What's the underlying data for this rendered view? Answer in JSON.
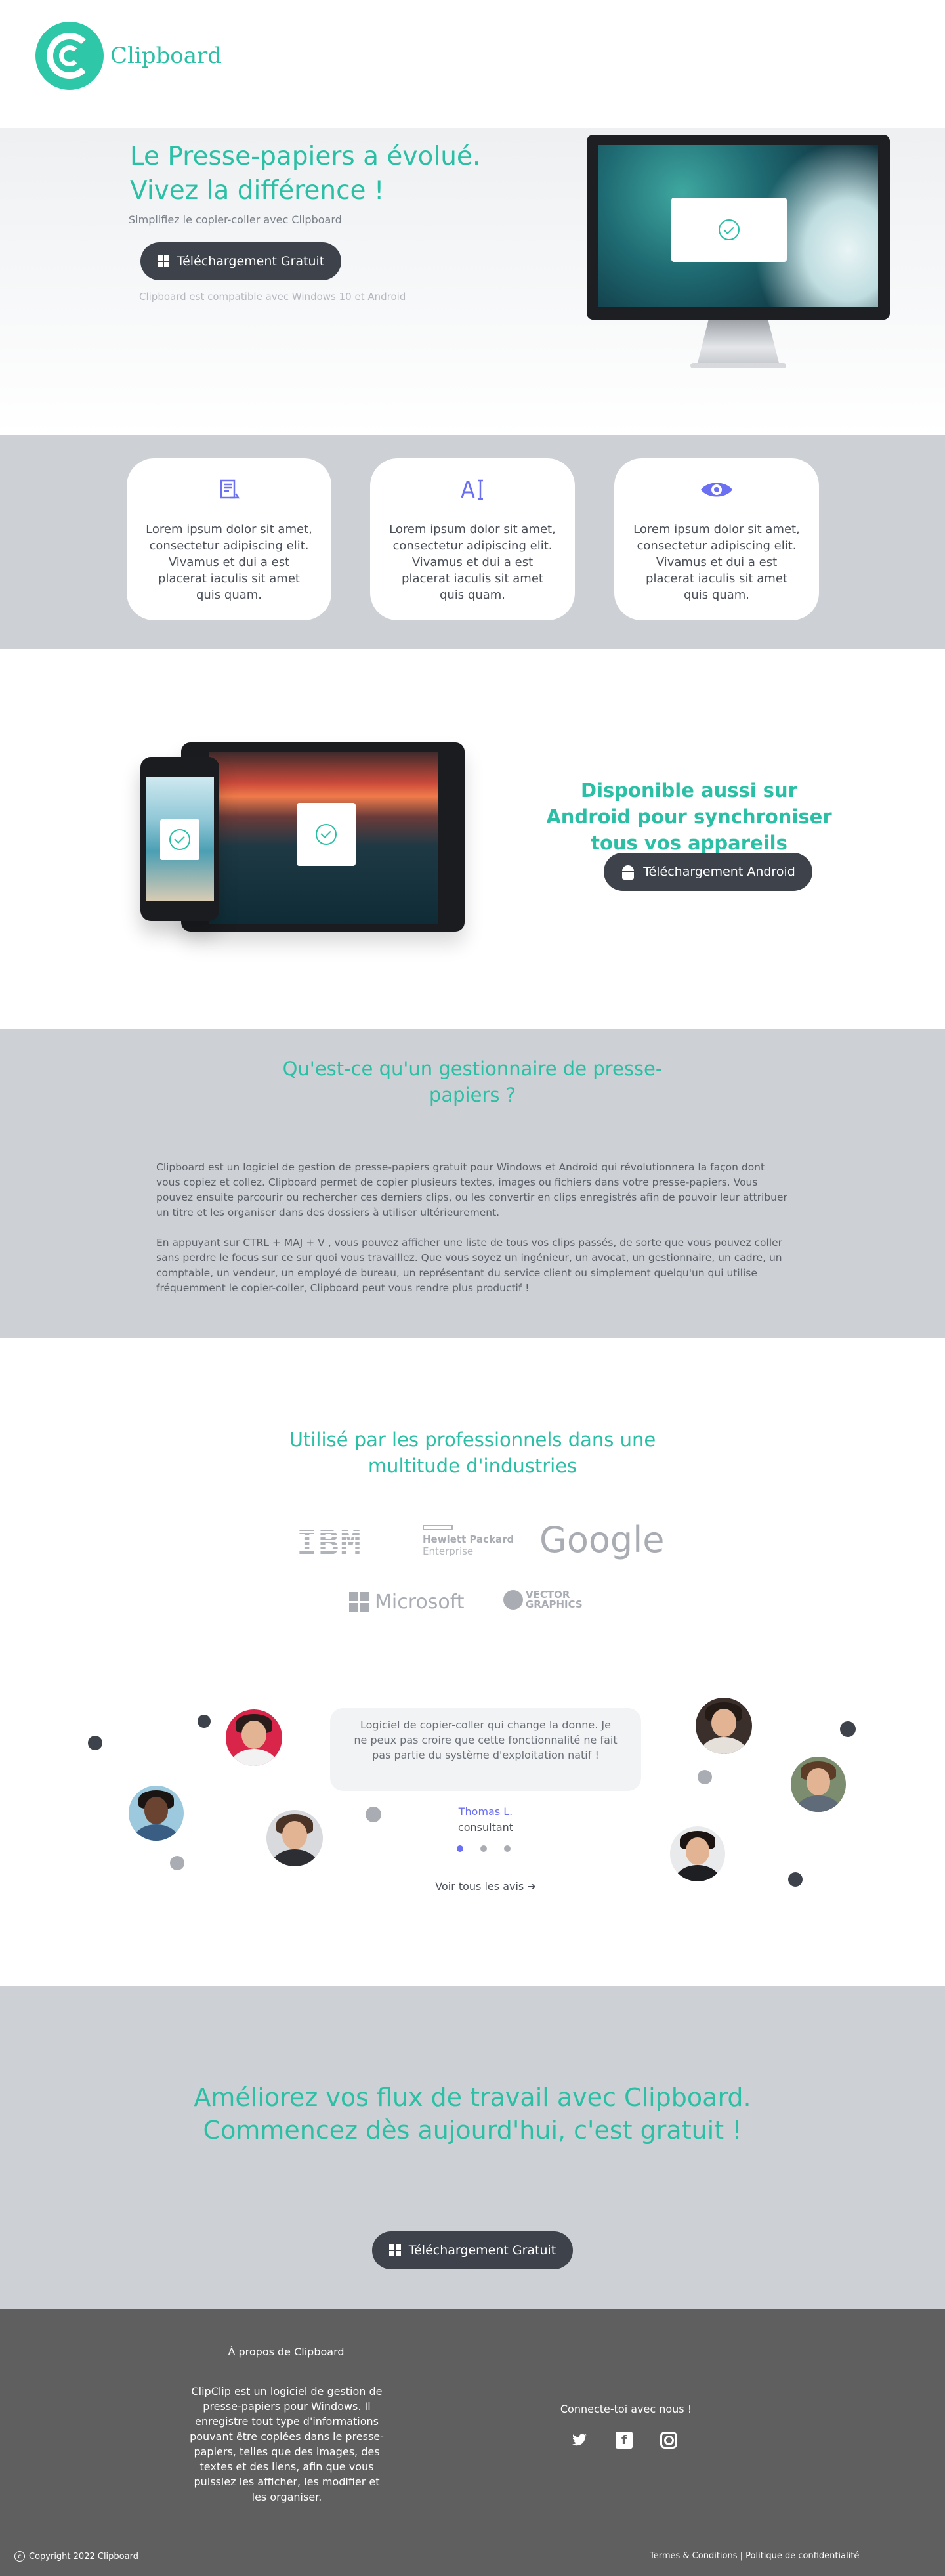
{
  "brand": {
    "name": "Clipboard",
    "accent": "#2bc0a5",
    "dark": "#3d424b",
    "muted": "#cdd1d5"
  },
  "hero": {
    "title": "Le Presse-papiers a évolué. Vivez la différence !",
    "subtitle": "Simplifiez le copier-coller avec Clipboard",
    "button": "Téléchargement Gratuit",
    "note": "Clipboard est compatible avec Windows 10 et Android"
  },
  "features": [
    {
      "icon": "document-icon",
      "text": "Lorem ipsum dolor sit amet, consectetur adipiscing elit. Vivamus et dui a est placerat iaculis sit amet quis quam."
    },
    {
      "icon": "text-cursor-icon",
      "text": "Lorem ipsum dolor sit amet, consectetur adipiscing elit. Vivamus et dui a est placerat iaculis sit amet quis quam."
    },
    {
      "icon": "eye-icon",
      "text": "Lorem ipsum dolor sit amet, consectetur adipiscing elit. Vivamus et dui a est placerat iaculis sit amet quis quam."
    }
  ],
  "android": {
    "title": "Disponible aussi sur Android pour synchroniser tous vos appareils",
    "button": "Téléchargement Android"
  },
  "about": {
    "title": "Qu'est-ce qu'un gestionnaire de presse-papiers ?",
    "paragraphs": [
      "Clipboard est un logiciel de gestion de presse-papiers gratuit pour Windows et Android qui révolutionnera la façon dont vous copiez et collez. Clipboard permet de copier plusieurs textes, images ou fichiers dans votre presse-papiers. Vous pouvez ensuite parcourir ou rechercher ces derniers clips, ou les convertir en clips enregistrés afin de pouvoir leur attribuer un titre et les organiser dans des dossiers à utiliser ultérieurement.",
      "En appuyant sur CTRL + MAJ + V , vous pouvez afficher une liste de tous vos clips passés, de sorte que vous pouvez coller sans perdre le focus sur ce sur quoi vous travaillez. Que vous soyez un ingénieur, un avocat, un gestionnaire, un cadre, un comptable, un vendeur, un employé de bureau, un représentant du service client ou simplement quelqu'un qui utilise fréquemment le copier-coller, Clipboard peut vous rendre plus productif !"
    ]
  },
  "clients": {
    "title": "Utilisé par les professionnels dans une multitude d'industries",
    "logos": {
      "ibm": "IBM",
      "hp_line1": "Hewlett Packard",
      "hp_line2": "Enterprise",
      "google": "Google",
      "microsoft": "Microsoft",
      "vector_line1": "VECTOR",
      "vector_line2": "GRAPHICS"
    }
  },
  "testimonial": {
    "quote": "Logiciel de copier-coller qui change la donne. Je ne peux pas croire que cette fonctionnalité ne fait pas partie du système d'exploitation natif !",
    "name": "Thomas L.",
    "role": "consultant",
    "active_dot": 1,
    "dot_count": 3,
    "all_reviews": "Voir tous les avis ➔"
  },
  "cta": {
    "title": "Améliorez vos flux de travail avec Clipboard. Commencez dès aujourd'hui, c'est gratuit !",
    "button": "Téléchargement Gratuit"
  },
  "footer": {
    "about_title": "À propos de Clipboard",
    "about_text": "ClipClip est un logiciel de gestion de presse-papiers pour Windows. Il enregistre tout type d'informations pouvant être copiées dans le presse-papiers, telles que des images, des textes et des liens, afin que vous puissiez les afficher, les modifier et les organiser.",
    "connect": "Connecte-toi avec nous !",
    "social": [
      "twitter-icon",
      "facebook-icon",
      "instagram-icon"
    ],
    "copyright": "Copyright 2022 Clipboard",
    "links": "Termes & Conditions | Politique de confidentialité"
  }
}
